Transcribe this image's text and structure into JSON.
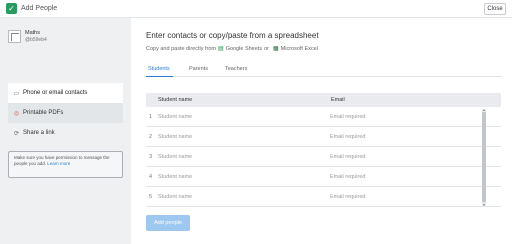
{
  "header": {
    "app_title": "Add People",
    "close_label": "Close"
  },
  "sidebar": {
    "class_name": "Maths",
    "class_code": "@b59eb4",
    "items": [
      {
        "label": "Phone or email contacts",
        "icon": "contact-card-icon"
      },
      {
        "label": "Printable PDFs",
        "icon": "pdf-icon"
      },
      {
        "label": "Share a link",
        "icon": "share-icon"
      }
    ],
    "notice_text": "Make sure you have permission to message the people you add.",
    "notice_link": "Learn more"
  },
  "main": {
    "heading": "Enter contacts or copy/paste from a spreadsheet",
    "sub_prefix": "Copy and paste directly from",
    "sheets_label": "Google Sheets",
    "sub_or": "or",
    "excel_label": "Microsoft Excel",
    "tabs": [
      {
        "label": "Students",
        "active": true
      },
      {
        "label": "Parents",
        "active": false
      },
      {
        "label": "Teachers",
        "active": false
      }
    ],
    "table": {
      "columns": [
        "Student name",
        "Email"
      ],
      "rows": [
        {
          "num": "1",
          "name": "Student name",
          "email": "Email required"
        },
        {
          "num": "2",
          "name": "Student name",
          "email": "Email required"
        },
        {
          "num": "3",
          "name": "Student name",
          "email": "Email required"
        },
        {
          "num": "4",
          "name": "Student name",
          "email": "Email required"
        },
        {
          "num": "5",
          "name": "Student name",
          "email": "Email required"
        }
      ]
    },
    "add_button": "Add people"
  },
  "colors": {
    "brand_green": "#2a9a61",
    "accent_blue": "#2a7dd1",
    "button_disabled": "#9ec8ef"
  }
}
